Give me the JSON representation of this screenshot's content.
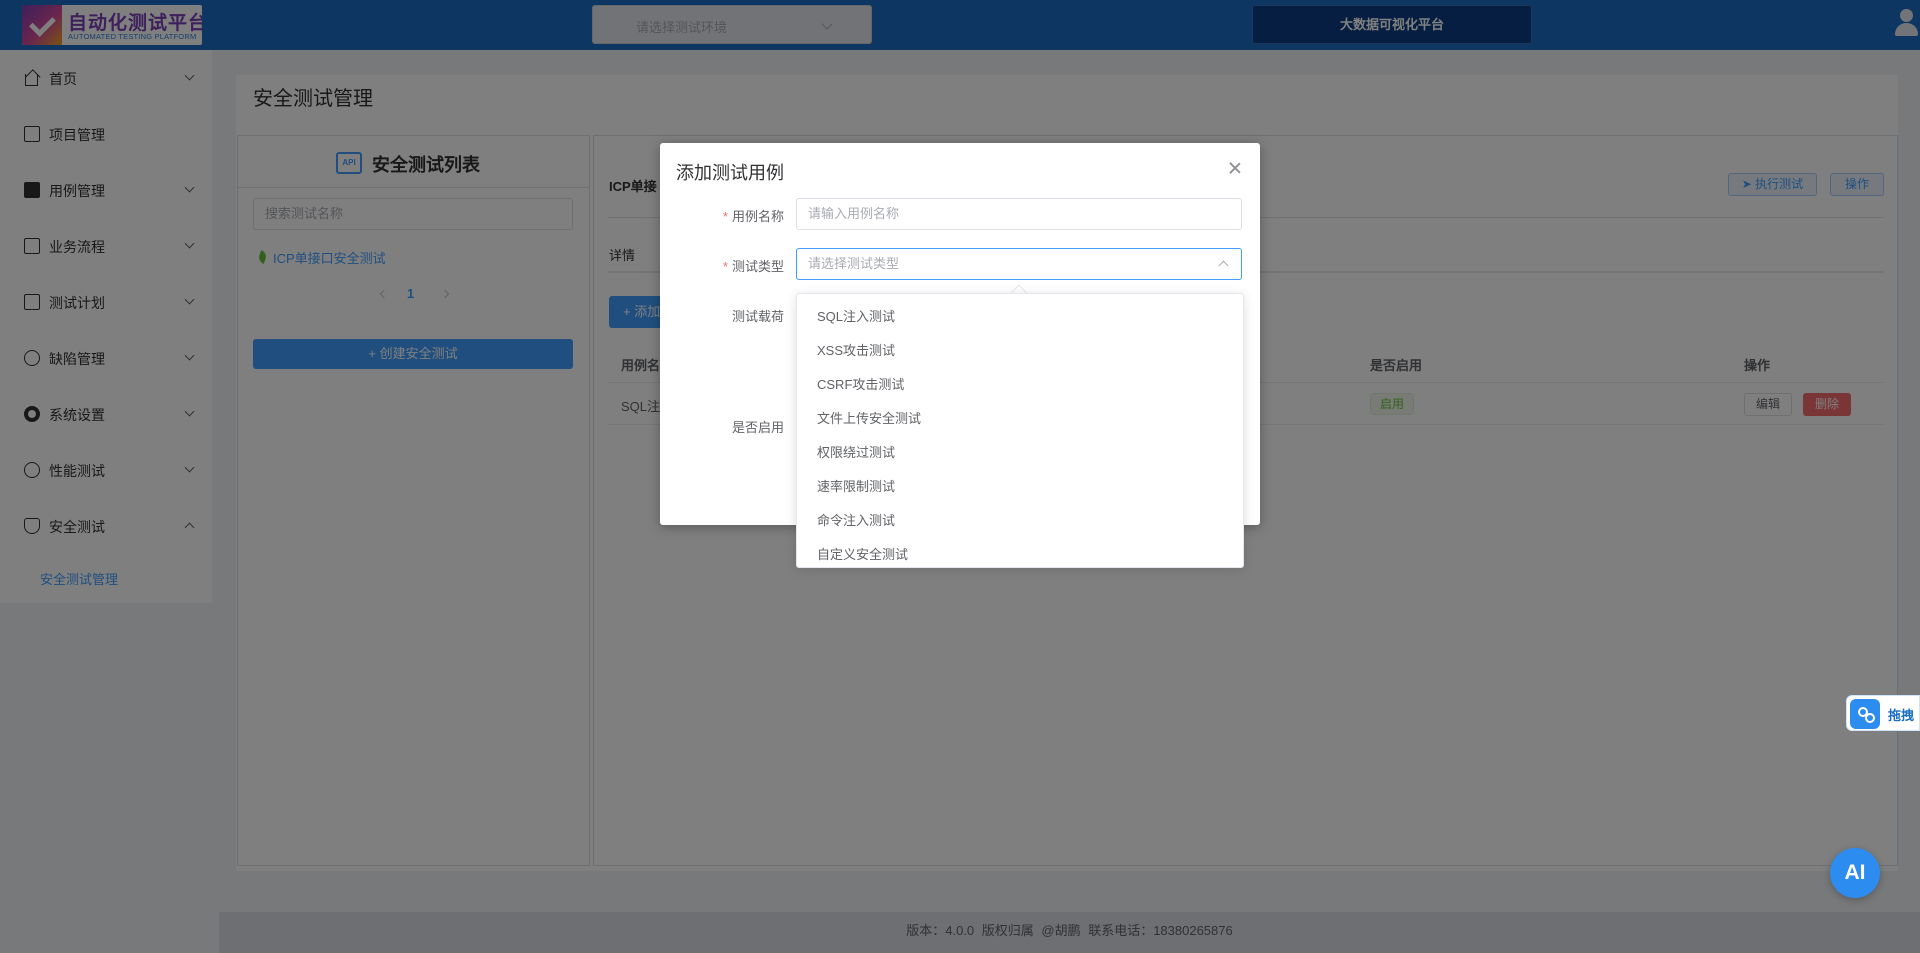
{
  "header": {
    "logo_title": "自动化测试平台",
    "logo_subtitle": "AUTOMATED TESTING PLATFORM",
    "env_placeholder": "请选择测试环境",
    "bigdata_label": "大数据可视化平台"
  },
  "sidebar": {
    "items": [
      {
        "label": "首页"
      },
      {
        "label": "项目管理"
      },
      {
        "label": "用例管理"
      },
      {
        "label": "业务流程"
      },
      {
        "label": "测试计划"
      },
      {
        "label": "缺陷管理"
      },
      {
        "label": "系统设置"
      },
      {
        "label": "性能测试"
      },
      {
        "label": "安全测试"
      }
    ],
    "submenu_active": "安全测试管理"
  },
  "page": {
    "title": "安全测试管理",
    "left_panel": {
      "api_icon_text": "API",
      "title": "安全测试列表",
      "search_placeholder": "搜索测试名称",
      "item": "ICP单接口安全测试",
      "current_page": "1",
      "create_button": "+ 创建安全测试"
    },
    "right_panel": {
      "test_name": "ICP单接",
      "execute_button": "➤ 执行测试",
      "ops_button": "操作",
      "tab_details": "详情",
      "add_button": "+ 添加",
      "table": {
        "headers": {
          "name": "用例名",
          "enabled": "是否启用",
          "actions": "操作"
        },
        "rows": [
          {
            "name": "SQL注",
            "enabled": "启用",
            "edit": "编辑",
            "delete": "删除"
          }
        ]
      }
    }
  },
  "footer": {
    "text": "版本：4.0.0    版权归属 @胡鹏    联系电话：18380265876"
  },
  "dialog": {
    "title": "添加测试用例",
    "fields": {
      "case_name_label": "用例名称",
      "case_name_placeholder": "请输入用例名称",
      "test_type_label": "测试类型",
      "test_type_placeholder": "请选择测试类型",
      "payload_label": "测试载荷",
      "enabled_label": "是否启用"
    },
    "dropdown_options": [
      "SQL注入测试",
      "XSS攻击测试",
      "CSRF攻击测试",
      "文件上传安全测试",
      "权限绕过测试",
      "速率限制测试",
      "命令注入测试",
      "自定义安全测试"
    ]
  },
  "floating": {
    "drag_label": "拖拽",
    "ai_label": "AI"
  },
  "colors": {
    "header": "#1a6fc4",
    "primary": "#409eff",
    "danger": "#f56c6c",
    "success": "#67c23a"
  }
}
